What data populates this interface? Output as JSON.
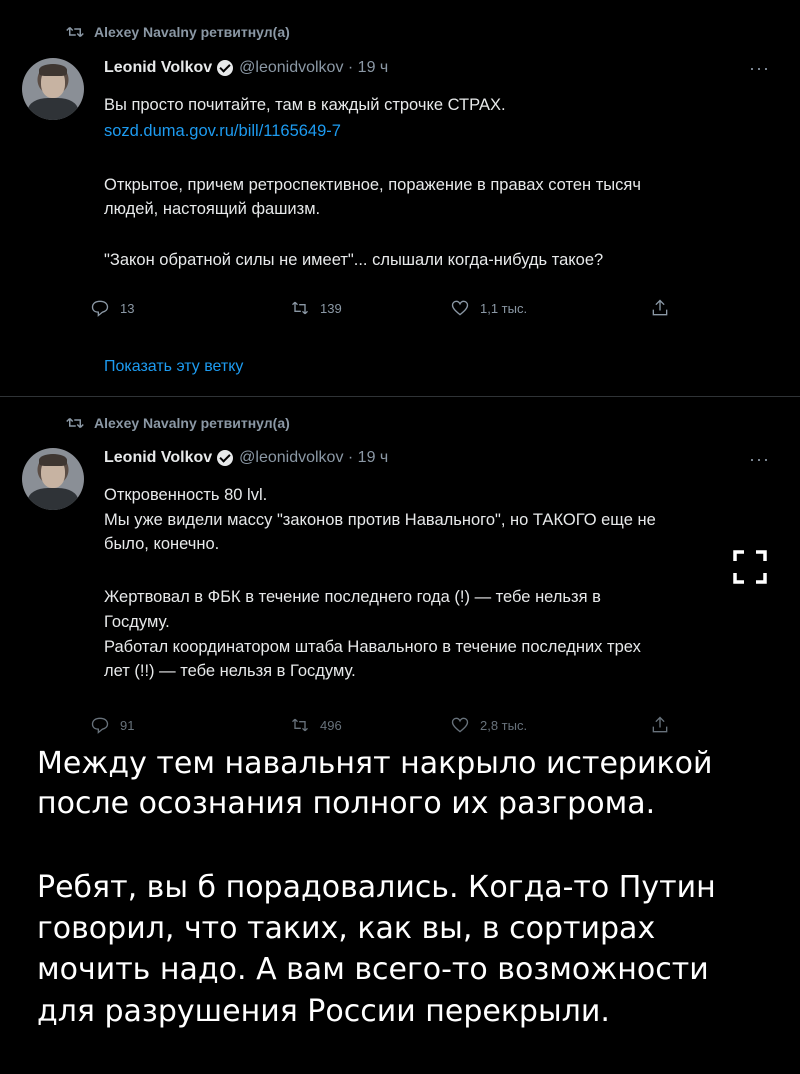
{
  "tweets": [
    {
      "retweeted_by": "Alexey Navalny ретвитнул(а)",
      "name": "Leonid Volkov",
      "handle_time": "@leonidvolkov · 19 ч",
      "more": "···",
      "lines": [
        "Вы просто почитайте, там в каждый строчке СТРАХ.",
        "sozd.duma.gov.ru/bill/1165649-7",
        "Открытое, причем ретроспективное, поражение в правах сотен тысяч",
        "людей, настоящий фашизм.",
        "\"Закон обратной силы не имеет\"... слышали когда-нибудь такое?"
      ],
      "replies": "13",
      "retweets": "139",
      "likes": "1,1 тыс.",
      "show_thread": "Показать эту ветку"
    },
    {
      "retweeted_by": "Alexey Navalny ретвитнул(а)",
      "name": "Leonid Volkov",
      "handle_time": "@leonidvolkov · 19 ч",
      "more": "···",
      "lines": [
        "Откровенность 80 lvl.",
        "Мы уже видели массу \"законов против Навального\", но ТАКОГО еще не",
        "было, конечно.",
        "Жертвовал в ФБК в течение последнего года (!) — тебе нельзя в",
        "Госдуму.",
        "Работал координатором штаба Навального в течение последних трех",
        "лет (!!) — тебе нельзя в Госдуму."
      ],
      "replies": "91",
      "retweets": "496",
      "likes": "2,8 тыс."
    }
  ],
  "caption": {
    "p1_l1": "Между тем навальнят накрыло истерикой",
    "p1_l2": "после осознания полного их разгрома.",
    "p2_l1": "Ребят, вы б порадовались. Когда-то Путин",
    "p2_l2": "говорил, что таких, как вы, в сортирах",
    "p2_l3": "мочить надо. А вам всего-то возможности",
    "p2_l4": "для разрушения России перекрыли."
  },
  "icons": {
    "retweet": "retweet-icon",
    "reply": "reply-icon",
    "like": "heart-icon",
    "share": "share-icon",
    "verified": "verified-badge-icon",
    "expand": "expand-icon"
  },
  "colors": {
    "background": "#000000",
    "text": "#e7e9ea",
    "secondary": "#8b98a5",
    "link": "#1d9bf0"
  }
}
